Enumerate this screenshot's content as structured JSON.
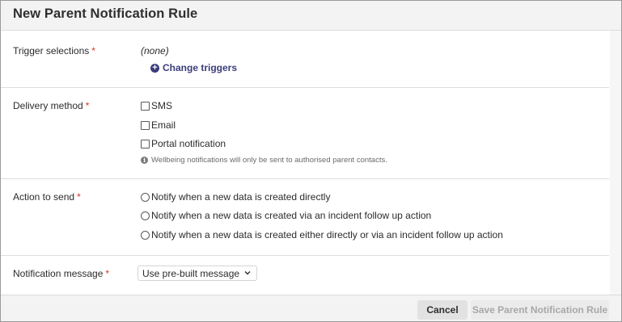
{
  "dialog": {
    "title": "New Parent Notification Rule"
  },
  "triggers": {
    "label": "Trigger selections",
    "required_mark": "*",
    "current_value": "(none)",
    "change_label": "Change triggers"
  },
  "delivery": {
    "label": "Delivery method",
    "required_mark": "*",
    "options": [
      {
        "label": "SMS",
        "checked": false
      },
      {
        "label": "Email",
        "checked": false
      },
      {
        "label": "Portal notification",
        "checked": false
      }
    ],
    "info_text": "Wellbeing notifications will only be sent to authorised parent contacts."
  },
  "action": {
    "label": "Action to send",
    "required_mark": "*",
    "options": [
      {
        "label": "Notify when a new data is created directly",
        "selected": false
      },
      {
        "label": "Notify when a new data is created via an incident follow up action",
        "selected": false
      },
      {
        "label": "Notify when a new data is created either directly or via an incident follow up action",
        "selected": false
      }
    ]
  },
  "message": {
    "label": "Notification message",
    "required_mark": "*",
    "selected": "Use pre-built message"
  },
  "footer": {
    "cancel_label": "Cancel",
    "save_label": "Save Parent Notification Rule"
  },
  "colors": {
    "accent": "#3a3d7a",
    "required": "#d9342b",
    "header_bg": "#f3f3f3",
    "disabled_text": "#a8a8a8"
  },
  "icons": {
    "change_triggers": "plus-circle-icon",
    "info": "info-circle-icon",
    "select_chevron": "chevron-down-icon"
  }
}
